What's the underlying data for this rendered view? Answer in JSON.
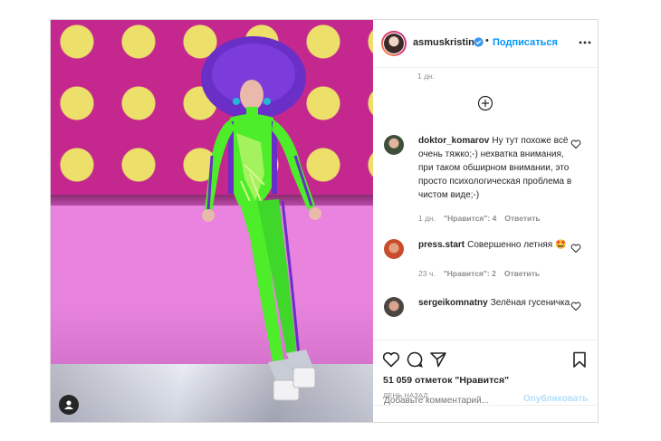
{
  "post": {
    "author": "asmuskristina",
    "follow_label": "Подписаться",
    "dot": "•",
    "top_time": "1 дн.",
    "comments": [
      {
        "user": "doktor_komarov",
        "text": "Ну тут похоже всё очень тяжко;-) нехватка внимания, при таком обширном внимании, это просто психологическая проблема в чистом виде;-)",
        "time": "1 дн.",
        "likes": "\"Нравится\": 4",
        "reply": "Ответить"
      },
      {
        "user": "press.start",
        "text": "Совершенно летняя 🤩",
        "time": "23 ч.",
        "likes": "\"Нравится\": 2",
        "reply": "Ответить"
      },
      {
        "user": "sergeikomnatny",
        "text": "Зелёная гусеничка",
        "time": "",
        "likes": "",
        "reply": ""
      }
    ],
    "likes_count": "51 059 отметок \"Нравится\"",
    "posted_ago": "ДЕНЬ НАЗАД",
    "comment_placeholder": "Добавьте комментарий...",
    "publish_label": "Опубликовать"
  },
  "colors": {
    "link_blue": "#0095f6",
    "publish_disabled": "#b2dffc",
    "wall_magenta": "#c4288f",
    "polka_yellow": "#ece06a",
    "suit_green": "#4ded2a",
    "hat_purple": "#6a2fc7"
  },
  "icons": [
    "verified-badge-icon",
    "more-options-icon",
    "load-more-plus-icon",
    "heart-icon",
    "comment-icon",
    "share-icon",
    "bookmark-icon",
    "user-tag-icon"
  ]
}
